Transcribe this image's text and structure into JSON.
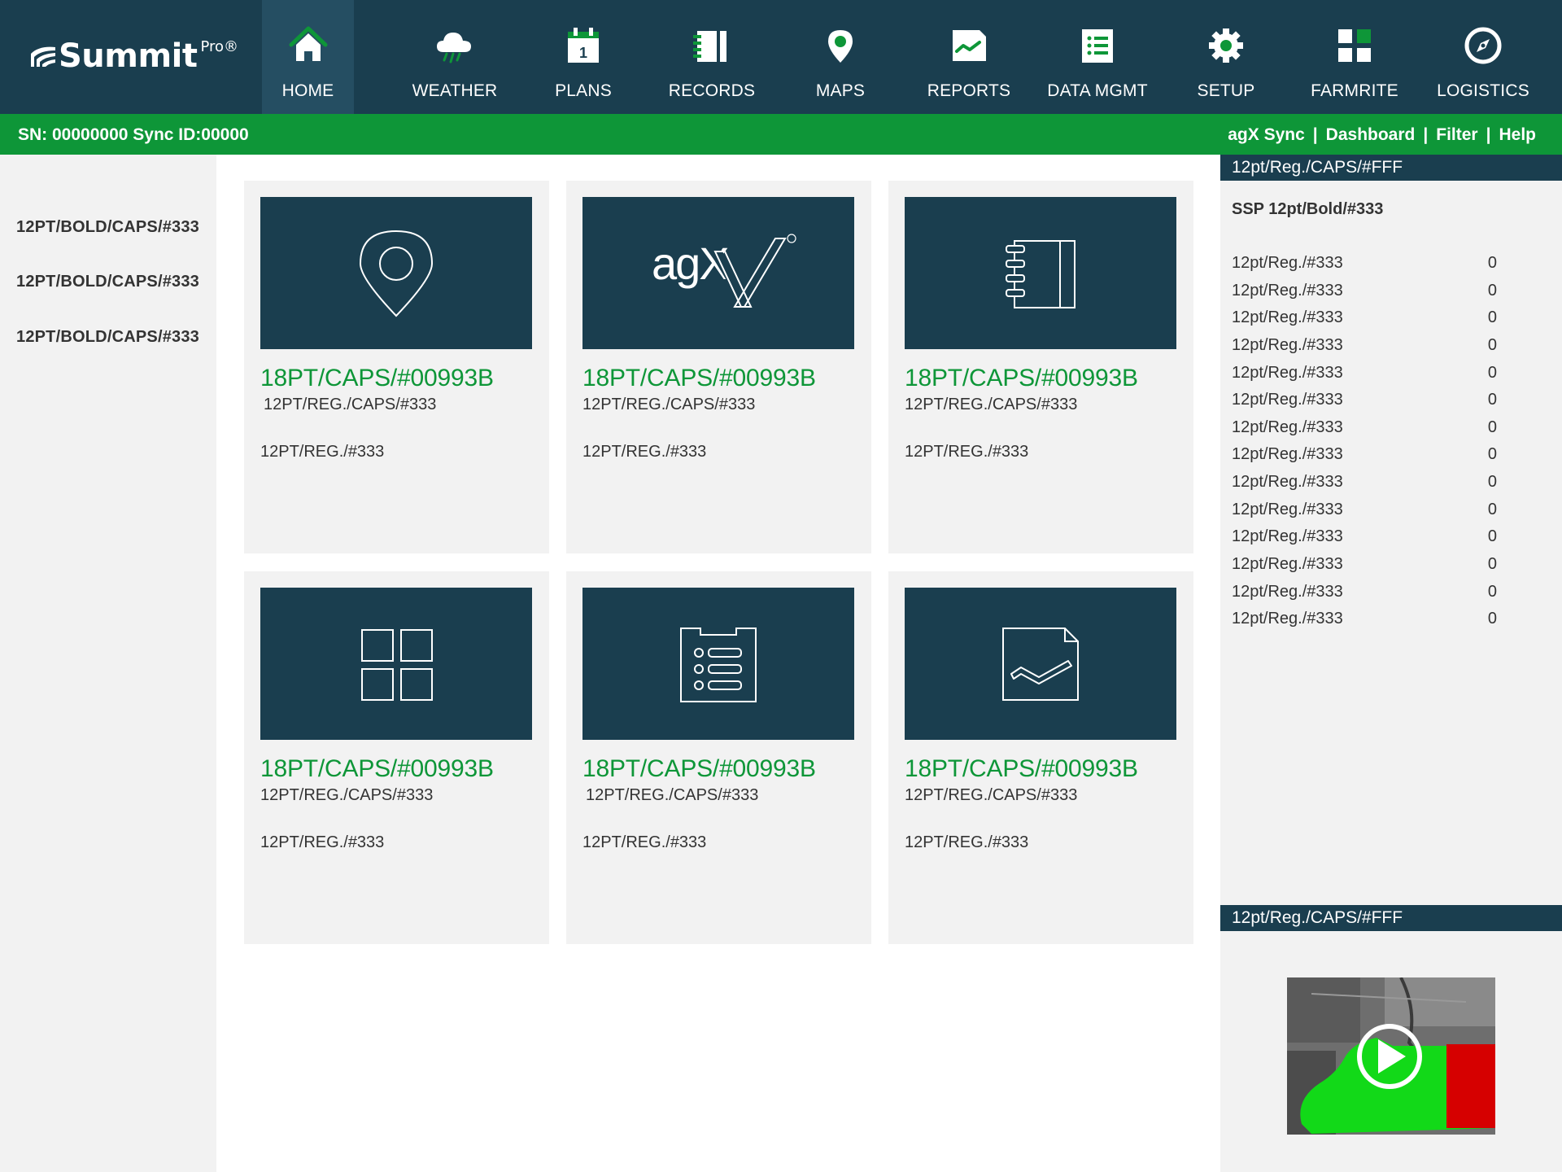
{
  "brand": {
    "name": "Summit",
    "superscript": "Pro®"
  },
  "nav": [
    {
      "label": "HOME",
      "icon": "home-icon",
      "active": true
    },
    {
      "label": "WEATHER",
      "icon": "weather-icon"
    },
    {
      "label": "PLANS",
      "icon": "calendar-icon"
    },
    {
      "label": "RECORDS",
      "icon": "records-icon"
    },
    {
      "label": "MAPS",
      "icon": "map-pin-icon"
    },
    {
      "label": "REPORTS",
      "icon": "report-icon"
    },
    {
      "label": "DATA MGMT",
      "icon": "data-list-icon"
    },
    {
      "label": "SETUP",
      "icon": "gear-icon"
    },
    {
      "label": "FARMRITE",
      "icon": "grid-icon"
    },
    {
      "label": "LOGISTICS",
      "icon": "compass-icon"
    }
  ],
  "calendar_day": "1",
  "status": {
    "sn": "SN: 00000000 Sync ID:00000",
    "links": [
      "agX Sync",
      "Dashboard",
      "Filter",
      "Help"
    ],
    "separator": "|"
  },
  "sidebar": [
    "12PT/BOLD/CAPS/#333",
    "12PT/BOLD/CAPS/#333",
    "12PT/BOLD/CAPS/#333"
  ],
  "tiles": [
    {
      "icon": "map-pin-icon",
      "title": "18PT/CAPS/#00993B",
      "subtitle": "12PT/REG./CAPS/#333",
      "desc": "12PT/REG./#333"
    },
    {
      "icon": "agx-logo",
      "logo_text": "agX",
      "title": "18PT/CAPS/#00993B",
      "subtitle": "12PT/REG./CAPS/#333",
      "desc": "12PT/REG./#333"
    },
    {
      "icon": "records-icon",
      "title": "18PT/CAPS/#00993B",
      "subtitle": "12PT/REG./CAPS/#333",
      "desc": "12PT/REG./#333"
    },
    {
      "icon": "grid-icon",
      "title": "18PT/CAPS/#00993B",
      "subtitle": "12PT/REG./CAPS/#333",
      "desc": "12PT/REG./#333"
    },
    {
      "icon": "data-list-icon",
      "title": "18PT/CAPS/#00993B",
      "subtitle": "12PT/REG./CAPS/#333",
      "desc": "12PT/REG./#333"
    },
    {
      "icon": "report-icon",
      "title": "18PT/CAPS/#00993B",
      "subtitle": "12PT/REG./CAPS/#333",
      "desc": "12PT/REG./#333"
    }
  ],
  "rightpanel": {
    "header1": "12pt/Reg./CAPS/#FFF",
    "subtitle": "SSP 12pt/Bold/#333",
    "stats": [
      {
        "label": "12pt/Reg./#333",
        "value": "0"
      },
      {
        "label": "12pt/Reg./#333",
        "value": "0"
      },
      {
        "label": "12pt/Reg./#333",
        "value": "0"
      },
      {
        "label": "12pt/Reg./#333",
        "value": "0"
      },
      {
        "label": "12pt/Reg./#333",
        "value": "0"
      },
      {
        "label": "12pt/Reg./#333",
        "value": "0"
      },
      {
        "label": "12pt/Reg./#333",
        "value": "0"
      },
      {
        "label": "12pt/Reg./#333",
        "value": "0"
      },
      {
        "label": "12pt/Reg./#333",
        "value": "0"
      },
      {
        "label": "12pt/Reg./#333",
        "value": "0"
      },
      {
        "label": "12pt/Reg./#333",
        "value": "0"
      },
      {
        "label": "12pt/Reg./#333",
        "value": "0"
      },
      {
        "label": "12pt/Reg./#333",
        "value": "0"
      },
      {
        "label": "12pt/Reg./#333",
        "value": "0"
      }
    ],
    "header2": "12pt/Reg./CAPS/#FFF",
    "video_icon": "play-icon"
  },
  "colors": {
    "navy": "#1a3e4f",
    "nav_active": "#254e62",
    "green": "#0e9638",
    "panel_gray": "#f2f2f2",
    "text": "#333333",
    "field_green": "#12d918",
    "field_red": "#d60000"
  }
}
